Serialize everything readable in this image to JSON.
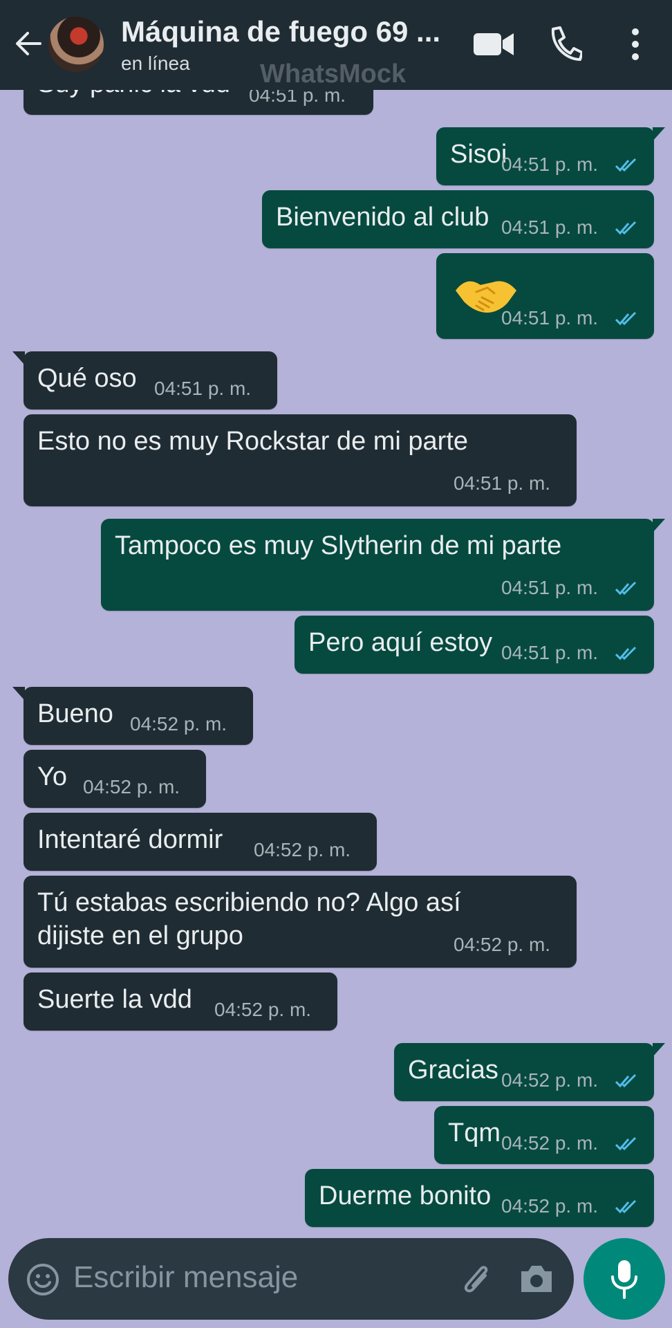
{
  "header": {
    "contact_name": "Máquina de fuego 69 ...",
    "status": "en línea",
    "watermark": "WhatsMock",
    "icons": [
      "back-arrow-icon",
      "video-call-icon",
      "phone-icon",
      "more-vert-icon"
    ]
  },
  "messages": [
    {
      "dir": "in",
      "text": "Suy panic la vdd",
      "time": "04:51 p. m."
    },
    {
      "dir": "out",
      "text": "Sisoi",
      "time": "04:51 p. m.",
      "read": true
    },
    {
      "dir": "out",
      "text": "Bienvenido al club",
      "time": "04:51 p. m.",
      "read": true
    },
    {
      "dir": "out",
      "text": "🤝",
      "time": "04:51 p. m.",
      "read": true
    },
    {
      "dir": "in",
      "text": "Qué oso",
      "time": "04:51 p. m."
    },
    {
      "dir": "in",
      "text": "Esto no es muy Rockstar de mi parte",
      "time": "04:51 p. m."
    },
    {
      "dir": "out",
      "text": "Tampoco es muy Slytherin de mi parte",
      "time": "04:51 p. m.",
      "read": true
    },
    {
      "dir": "out",
      "text": "Pero aquí estoy",
      "time": "04:51 p. m.",
      "read": true
    },
    {
      "dir": "in",
      "text": "Bueno",
      "time": "04:52 p. m."
    },
    {
      "dir": "in",
      "text": "Yo",
      "time": "04:52 p. m."
    },
    {
      "dir": "in",
      "text": "Intentaré dormir",
      "time": "04:52 p. m."
    },
    {
      "dir": "in",
      "text_line1": "Tú estabas escribiendo no? Algo así",
      "text_line2": "dijiste en el grupo",
      "time": "04:52 p. m."
    },
    {
      "dir": "in",
      "text": "Suerte la vdd",
      "time": "04:52 p. m."
    },
    {
      "dir": "out",
      "text": "Gracias",
      "time": "04:52 p. m.",
      "read": true
    },
    {
      "dir": "out",
      "text": "Tqm",
      "time": "04:52 p. m.",
      "read": true
    },
    {
      "dir": "out",
      "text": "Duerme bonito",
      "time": "04:52 p. m.",
      "read": true
    }
  ],
  "input": {
    "placeholder": "Escribir mensaje",
    "icons": [
      "emoji-icon",
      "attach-clip-icon",
      "camera-icon",
      "microphone-icon"
    ]
  },
  "colors": {
    "wallpaper": "#b4b2d8",
    "header": "#1f2c34",
    "incoming_bubble": "#202c33",
    "outgoing_bubble": "#064a3f",
    "read_tick": "#53bdeb",
    "mic_button": "#00897b"
  }
}
